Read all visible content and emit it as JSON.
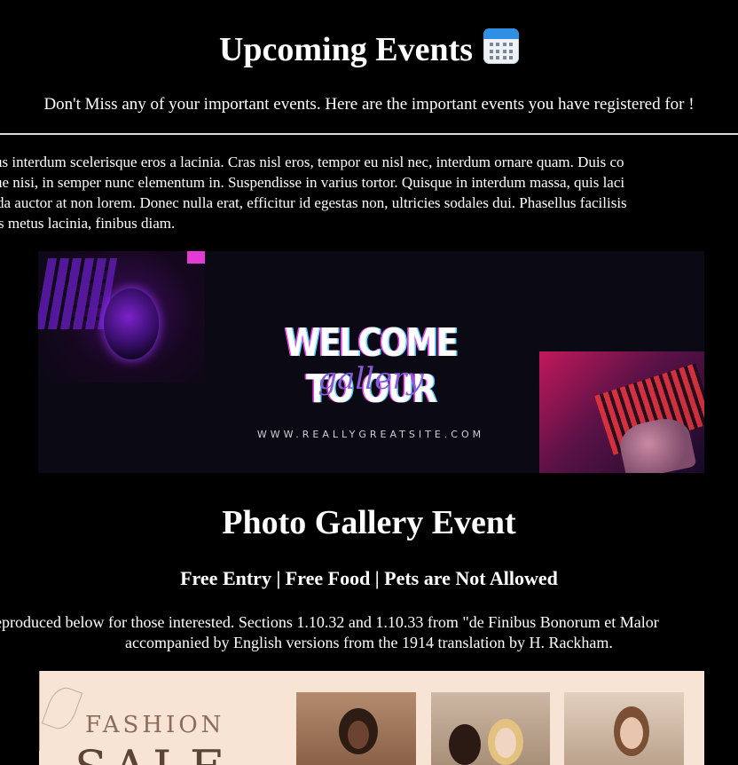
{
  "header": {
    "title": "Upcoming Events",
    "title_icon": "calendar-icon",
    "subtitle": "Don't Miss any of your important events. Here are the important events you have registered for !"
  },
  "intro_lines": [
    "us interdum scelerisque eros a lacinia. Cras nisl eros, tempor eu nisl nec, interdum ornare quam. Duis co",
    "ue nisi, in semper nunc elementum in. Suspendisse in varius tortor. Quisque in interdum massa, quis laci",
    "da auctor at non lorem. Donec nulla erat, efficitur id egestas non, ultricies sodales dui. Phasellus facilisis",
    "s metus lacinia, finibus diam."
  ],
  "banner": {
    "headline": "WELCOME TO OUR",
    "script": "gallery",
    "website": "WWW.REALLYGREATSITE.COM"
  },
  "event": {
    "title": "Photo Gallery Event",
    "features": "Free Entry | Free Food | Pets are Not Allowed",
    "description_line1": "eproduced below for those interested. Sections 1.10.32 and 1.10.33 from \"de Finibus Bonorum et Malor",
    "description_line2": "accompanied by English versions from the 1914 translation by H. Rackham."
  },
  "fashion_banner": {
    "word1": "FASHION",
    "word2": "SALE"
  },
  "colors": {
    "background": "#000000",
    "text": "#ffffff",
    "divider": "#d9d9d9",
    "fashion_bg": "#f7e4d5"
  }
}
